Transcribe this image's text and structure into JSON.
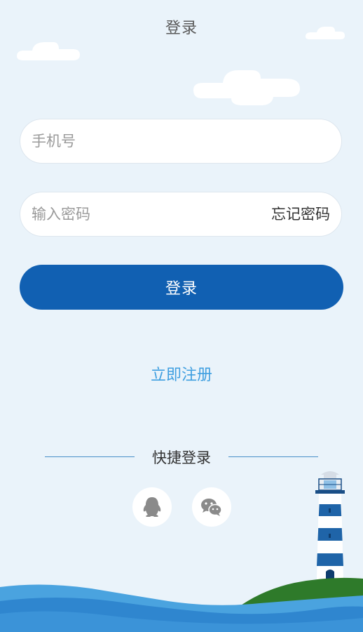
{
  "header": {
    "title": "登录"
  },
  "phone": {
    "placeholder": "手机号"
  },
  "password": {
    "placeholder": "输入密码",
    "forgot_label": "忘记密码"
  },
  "login_button": {
    "label": "登录"
  },
  "register_link": {
    "label": "立即注册"
  },
  "quick_login": {
    "label": "快捷登录",
    "options": [
      {
        "icon": "qq-icon"
      },
      {
        "icon": "wechat-icon"
      }
    ]
  },
  "colors": {
    "background": "#eaf3fa",
    "primary": "#1160b2",
    "link": "#3f9fe0",
    "sea": "#3a8fd4",
    "hill": "#2e7a2a"
  }
}
